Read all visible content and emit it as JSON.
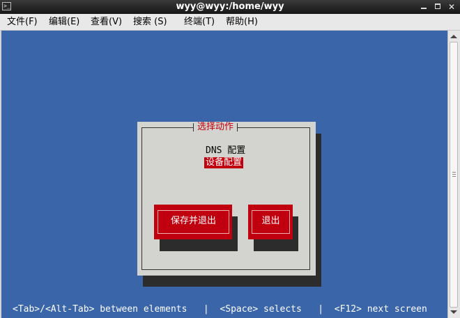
{
  "window": {
    "title": "wyy@wyy:/home/wyy",
    "icon": "terminal-icon",
    "controls": [
      "minimize-icon",
      "maximize-icon",
      "close-icon"
    ]
  },
  "menubar": {
    "items": [
      "文件(F)",
      "编辑(E)",
      "查看(V)",
      "搜索 (S)",
      "终端(T)",
      "帮助(H)"
    ]
  },
  "dialog": {
    "title": "选择动作",
    "options": [
      "DNS 配置",
      "设备配置"
    ],
    "selected_option": "设备配置",
    "buttons": {
      "save_exit": "保存并退出",
      "exit": "退出"
    }
  },
  "statusline": {
    "text": "<Tab>/<Alt-Tab> between elements   |  <Space> selects   |  <F12> next screen"
  },
  "colors": {
    "terminal_bg": "#3a65a8",
    "dialog_bg": "#d3d4cf",
    "accent_red": "#c0000e",
    "shadow": "#2c2c2c"
  }
}
